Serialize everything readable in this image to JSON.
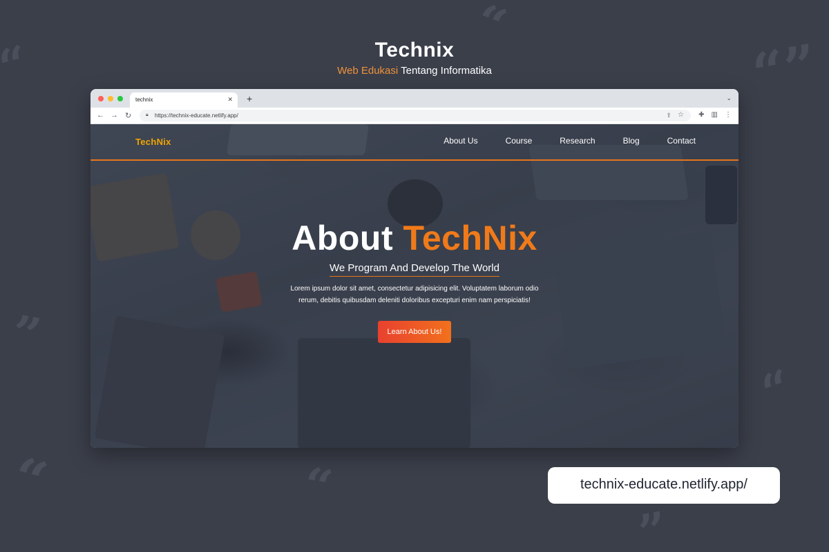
{
  "page": {
    "title": "Technix",
    "subtitle_accent": "Web Edukasi",
    "subtitle_rest": "Tentang Informatika",
    "url_badge": "technix-educate.netlify.app/",
    "colors": {
      "background": "#3b3f4a",
      "accent": "#f0923a"
    }
  },
  "browser": {
    "tab_title": "technix",
    "tab_close_icon": "close-icon",
    "new_tab_icon": "plus-icon",
    "tab_menu_icon": "chevron-down-icon",
    "url": "https://technix-educate.netlify.app/",
    "nav_icons": [
      "back-arrow-icon",
      "forward-arrow-icon",
      "reload-icon"
    ],
    "toolbar_icons": [
      "share-icon",
      "star-icon",
      "extensions-icon",
      "sidepanel-icon",
      "more-icon"
    ]
  },
  "site": {
    "logo": "TechNix",
    "nav": [
      "About Us",
      "Course",
      "Research",
      "Blog",
      "Contact"
    ],
    "hero": {
      "title_white": "About",
      "title_accent": "TechNix",
      "subtitle": "We Program And Develop The World",
      "body": "Lorem ipsum dolor sit amet, consectetur adipisicing elit. Voluptatem laborum odio rerum, debitis quibusdam deleniti doloribus excepturi enim nam perspiciatis!",
      "button": "Learn About Us!"
    },
    "colors": {
      "logo": "#f0a500",
      "accent": "#f07a1a",
      "button_start": "#e8412f",
      "button_end": "#f2711c"
    }
  }
}
